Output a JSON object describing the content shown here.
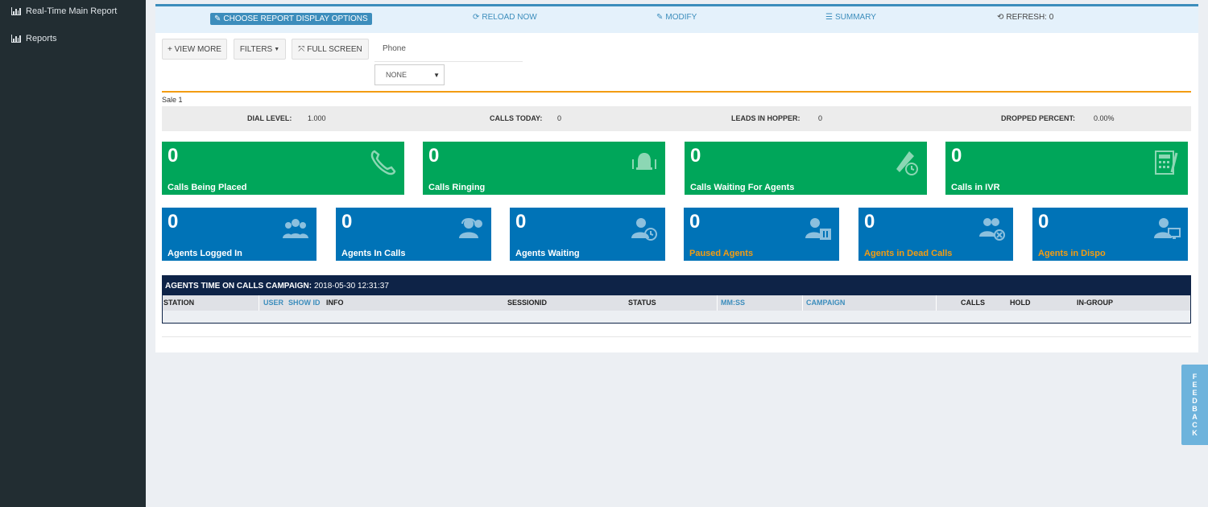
{
  "sidebar": {
    "items": [
      {
        "label": "Real-Time Main Report",
        "icon": "bar-chart-icon"
      },
      {
        "label": "Reports",
        "icon": "bar-chart-icon"
      }
    ]
  },
  "topbar": {
    "choose_label": "CHOOSE REPORT DISPLAY OPTIONS",
    "reload_label": "RELOAD NOW",
    "modify_label": "MODIFY",
    "summary_label": "SUMMARY",
    "refresh_label": "REFRESH: 0"
  },
  "toolbar": {
    "view_more_label": "+ VIEW MORE",
    "filters_label": "FILTERS",
    "fullscreen_label": "FULL SCREEN",
    "phone_label": "Phone",
    "phone_selected": "NONE"
  },
  "campaign_label": "Sale 1",
  "stats": {
    "dial_level_label": "DIAL LEVEL:",
    "dial_level_value": "1.000",
    "calls_today_label": "CALLS TODAY:",
    "calls_today_value": "0",
    "leads_label": "LEADS IN HOPPER:",
    "leads_value": "0",
    "dropped_label": "DROPPED PERCENT:",
    "dropped_value": "0.00%"
  },
  "call_cards": [
    {
      "value": "0",
      "label": "Calls Being Placed"
    },
    {
      "value": "0",
      "label": "Calls Ringing"
    },
    {
      "value": "0",
      "label": "Calls Waiting For Agents"
    },
    {
      "value": "0",
      "label": "Calls in IVR"
    }
  ],
  "agent_cards": [
    {
      "value": "0",
      "label": "Agents Logged In"
    },
    {
      "value": "0",
      "label": "Agents In Calls"
    },
    {
      "value": "0",
      "label": "Agents Waiting"
    },
    {
      "value": "0",
      "label": "Paused Agents"
    },
    {
      "value": "0",
      "label": "Agents in Dead Calls"
    },
    {
      "value": "0",
      "label": "Agents in Dispo"
    }
  ],
  "agents_table": {
    "title": "AGENTS TIME ON CALLS CAMPAIGN:",
    "timestamp": "2018-05-30 12:31:37",
    "columns": {
      "station": "STATION",
      "user": "USER",
      "show_id": "SHOW ID",
      "info": "INFO",
      "sessionid": "SESSIONID",
      "status": "STATUS",
      "mmss": "MM:SS",
      "campaign": "CAMPAIGN",
      "calls": "CALLS",
      "hold": "HOLD",
      "ingroup": "IN-GROUP"
    }
  },
  "feedback_letters": [
    "F",
    "E",
    "E",
    "D",
    "B",
    "A",
    "C",
    "K"
  ],
  "colors": {
    "sidebar": "#222d32",
    "accent": "#3c8dbc",
    "green": "#00a65a",
    "blue": "#0073b7",
    "orange": "#f39c12",
    "navy": "#0e2347"
  }
}
